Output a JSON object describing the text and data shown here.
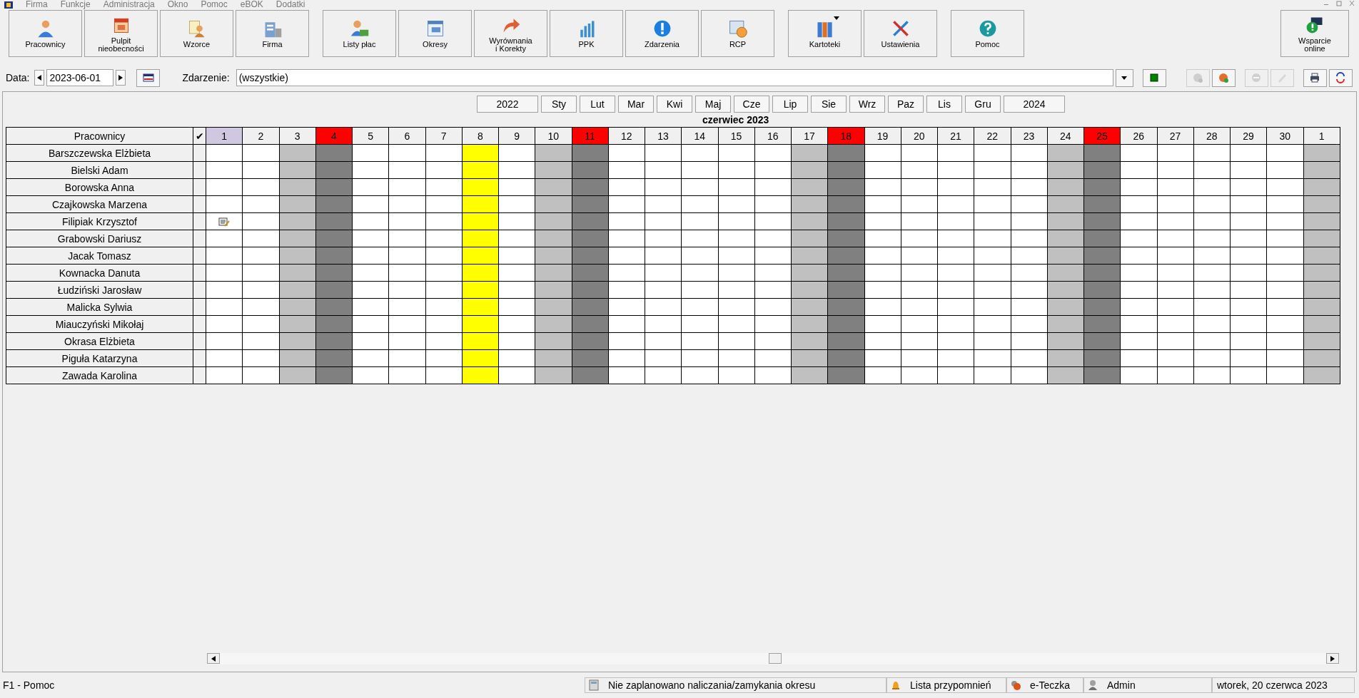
{
  "menu": [
    "Firma",
    "Funkcje",
    "Administracja",
    "Okno",
    "Pomoc",
    "eBOK",
    "Dodatki"
  ],
  "toolbar": {
    "groups": [
      [
        {
          "label": "Pracownicy",
          "dropdown": false
        },
        {
          "label": "Pulpit\nnieobecności",
          "dropdown": false
        },
        {
          "label": "Wzorce",
          "dropdown": false
        },
        {
          "label": "Firma",
          "dropdown": false
        }
      ],
      [
        {
          "label": "Listy płac",
          "dropdown": false
        },
        {
          "label": "Okresy",
          "dropdown": false
        },
        {
          "label": "Wyrównania\ni Korekty",
          "dropdown": false
        },
        {
          "label": "PPK",
          "dropdown": false
        },
        {
          "label": "Zdarzenia",
          "dropdown": false
        },
        {
          "label": "RCP",
          "dropdown": false
        }
      ],
      [
        {
          "label": "Kartoteki",
          "dropdown": true
        },
        {
          "label": "Ustawienia",
          "dropdown": false
        }
      ],
      [
        {
          "label": "Pomoc",
          "dropdown": false
        }
      ]
    ],
    "right": {
      "label": "Wsparcie\nonline"
    }
  },
  "filter": {
    "date_label": "Data:",
    "date": "2023-06-01",
    "event_label": "Zdarzenie:",
    "event": "(wszystkie)"
  },
  "actions": [
    {
      "disabled": false
    },
    {
      "disabled": true
    },
    {
      "disabled": false
    },
    {
      "disabled": true
    },
    {
      "disabled": true
    },
    {
      "disabled": false
    },
    {
      "disabled": false
    }
  ],
  "month_nav": [
    "2022",
    "Sty",
    "Lut",
    "Mar",
    "Kwi",
    "Maj",
    "Cze",
    "Lip",
    "Sie",
    "Wrz",
    "Paz",
    "Lis",
    "Gru",
    "2024"
  ],
  "calendar": {
    "title": "czerwiec 2023",
    "name_header": "Pracownicy",
    "check_header": "✔",
    "days": [
      {
        "label": "1",
        "kind": "workday",
        "selected": true
      },
      {
        "label": "2",
        "kind": "workday",
        "selected": false
      },
      {
        "label": "3",
        "kind": "saturday",
        "selected": false
      },
      {
        "label": "4",
        "kind": "sunday",
        "selected": false
      },
      {
        "label": "5",
        "kind": "workday",
        "selected": false
      },
      {
        "label": "6",
        "kind": "workday",
        "selected": false
      },
      {
        "label": "7",
        "kind": "workday",
        "selected": false
      },
      {
        "label": "8",
        "kind": "holiday",
        "selected": false
      },
      {
        "label": "9",
        "kind": "workday",
        "selected": false
      },
      {
        "label": "10",
        "kind": "saturday",
        "selected": false
      },
      {
        "label": "11",
        "kind": "sunday",
        "selected": false
      },
      {
        "label": "12",
        "kind": "workday",
        "selected": false
      },
      {
        "label": "13",
        "kind": "workday",
        "selected": false
      },
      {
        "label": "14",
        "kind": "workday",
        "selected": false
      },
      {
        "label": "15",
        "kind": "workday",
        "selected": false
      },
      {
        "label": "16",
        "kind": "workday",
        "selected": false
      },
      {
        "label": "17",
        "kind": "saturday",
        "selected": false
      },
      {
        "label": "18",
        "kind": "sunday",
        "selected": false
      },
      {
        "label": "19",
        "kind": "workday",
        "selected": false
      },
      {
        "label": "20",
        "kind": "workday",
        "selected": false
      },
      {
        "label": "21",
        "kind": "workday",
        "selected": false
      },
      {
        "label": "22",
        "kind": "workday",
        "selected": false
      },
      {
        "label": "23",
        "kind": "workday",
        "selected": false
      },
      {
        "label": "24",
        "kind": "saturday",
        "selected": false
      },
      {
        "label": "25",
        "kind": "sunday",
        "selected": false
      },
      {
        "label": "26",
        "kind": "workday",
        "selected": false
      },
      {
        "label": "27",
        "kind": "workday",
        "selected": false
      },
      {
        "label": "28",
        "kind": "workday",
        "selected": false
      },
      {
        "label": "29",
        "kind": "workday",
        "selected": false
      },
      {
        "label": "30",
        "kind": "workday",
        "selected": false
      },
      {
        "label": "1",
        "kind": "saturday",
        "selected": false
      }
    ],
    "rows": [
      {
        "name": "Barszczewska Elżbieta",
        "has_note": false
      },
      {
        "name": "Bielski Adam",
        "has_note": false
      },
      {
        "name": "Borowska Anna",
        "has_note": false
      },
      {
        "name": "Czajkowska Marzena",
        "has_note": false
      },
      {
        "name": "Filipiak Krzysztof",
        "has_note": true
      },
      {
        "name": "Grabowski Dariusz",
        "has_note": false
      },
      {
        "name": "Jacak Tomasz",
        "has_note": false
      },
      {
        "name": "Kownacka Danuta",
        "has_note": false
      },
      {
        "name": "Łudziński Jarosław",
        "has_note": false
      },
      {
        "name": "Malicka Sylwia",
        "has_note": false
      },
      {
        "name": "Miauczyński Mikołaj",
        "has_note": false
      },
      {
        "name": "Okrasa Elżbieta",
        "has_note": false
      },
      {
        "name": "Piguła Katarzyna",
        "has_note": false
      },
      {
        "name": "Zawada Karolina",
        "has_note": false
      }
    ]
  },
  "status_bar": {
    "help": "F1 - Pomoc",
    "panels": [
      "Nie zaplanowano naliczania/zamykania okresu",
      "Lista przypomnień",
      "e-Teczka",
      "Admin",
      "wtorek, 20 czerwca 2023"
    ]
  }
}
